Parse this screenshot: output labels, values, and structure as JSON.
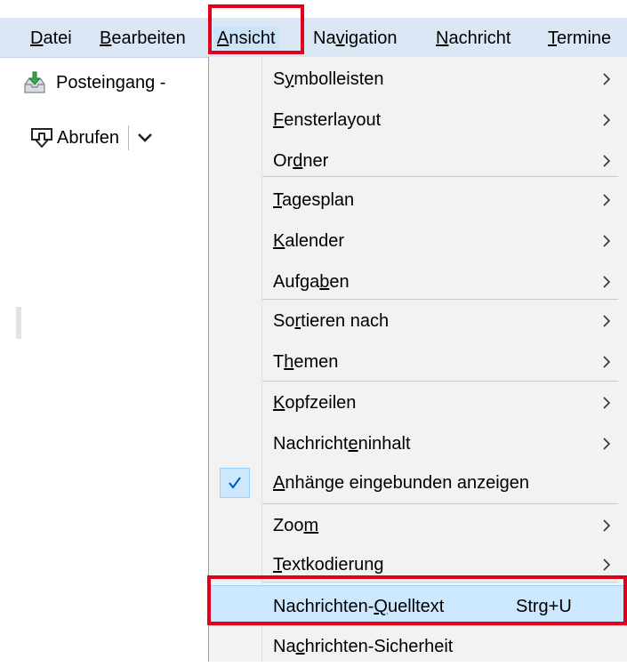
{
  "menubar": {
    "items": [
      {
        "label": "Datei",
        "ul_pre": "",
        "ul": "D",
        "ul_post": "atei"
      },
      {
        "label": "Bearbeiten",
        "ul_pre": "",
        "ul": "B",
        "ul_post": "earbeiten"
      },
      {
        "label": "Ansicht",
        "ul_pre": "",
        "ul": "A",
        "ul_post": "nsicht"
      },
      {
        "label": "Navigation",
        "ul_pre": "Na",
        "ul": "v",
        "ul_post": "igation"
      },
      {
        "label": "Nachricht",
        "ul_pre": "",
        "ul": "N",
        "ul_post": "achricht"
      },
      {
        "label": "Termine",
        "ul_pre": "",
        "ul": "T",
        "ul_post": "ermine"
      }
    ]
  },
  "tab": {
    "label": "Posteingang -"
  },
  "toolbar": {
    "get_label": "Abrufen"
  },
  "menu": {
    "items": [
      {
        "pre": "S",
        "ul": "y",
        "post": "mbolleisten"
      },
      {
        "pre": "",
        "ul": "F",
        "post": "ensterlayout"
      },
      {
        "pre": "Or",
        "ul": "d",
        "post": "ner"
      },
      {
        "pre": "",
        "ul": "T",
        "post": "agesplan"
      },
      {
        "pre": "",
        "ul": "K",
        "post": "alender"
      },
      {
        "pre": "Aufga",
        "ul": "b",
        "post": "en"
      },
      {
        "pre": "So",
        "ul": "r",
        "post": "tieren nach"
      },
      {
        "pre": "T",
        "ul": "h",
        "post": "emen"
      },
      {
        "pre": "",
        "ul": "K",
        "post": "opfzeilen"
      },
      {
        "pre": "Nachricht",
        "ul": "e",
        "post": "ninhalt"
      },
      {
        "pre": "",
        "ul": "A",
        "post": "nhänge eingebunden anzeigen"
      },
      {
        "pre": "Zoo",
        "ul": "m",
        "post": ""
      },
      {
        "pre": "",
        "ul": "T",
        "post": "extkodierung"
      },
      {
        "pre": "Nachrichten-",
        "ul": "Q",
        "post": "uelltext",
        "shortcut": "Strg+U"
      },
      {
        "pre": "Na",
        "ul": "c",
        "post": "hrichten-Sicherheit"
      }
    ]
  },
  "colors": {
    "highlight_box": "#e0001b",
    "menubar_bg": "#dbe7f5",
    "menu_hover": "#cce8ff",
    "check_color": "#0055c4"
  },
  "icons": {
    "inbox": "inbox-download-icon",
    "get": "get-messages-icon",
    "check": "checkmark-icon",
    "submenu": "chevron-right-icon"
  }
}
